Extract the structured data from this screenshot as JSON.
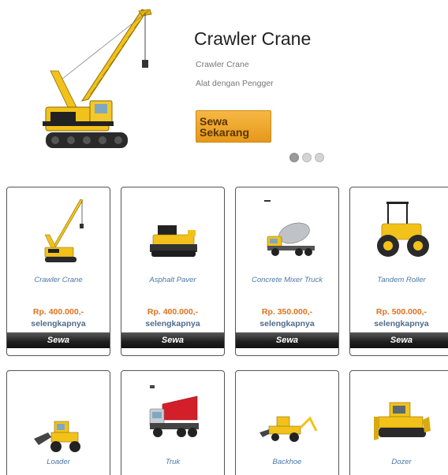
{
  "hero": {
    "title": "Crawler Crane",
    "subtitle": "Crawler Crane",
    "description": "Alat dengan Pengger",
    "button_line1": "Sewa",
    "button_line2": "Sekarang",
    "slide_count": 3,
    "active_slide": 1
  },
  "colors": {
    "accent_orange": "#e6981a",
    "price_orange": "#e0701c",
    "link_blue": "#4a78a8",
    "button_dark": "#1e1e1e"
  },
  "products": [
    {
      "name": "Crawler Crane",
      "price": "Rp. 400.000,-",
      "more": "selengkapnya",
      "action": "Sewa",
      "icon": "crane-icon"
    },
    {
      "name": "Asphalt Paver",
      "price": "Rp. 400.000,-",
      "more": "selengkapnya",
      "action": "Sewa",
      "icon": "asphalt-paver-icon"
    },
    {
      "name": "Concrete Mixer Truck",
      "price": "Rp. 350.000,-",
      "more": "selengkapnya",
      "action": "Sewa",
      "icon": "mixer-truck-icon"
    },
    {
      "name": "Tandem Roller",
      "price": "Rp. 500.000,-",
      "more": "selengkapnya",
      "action": "Sewa",
      "icon": "roller-icon"
    },
    {
      "name": "Loader",
      "icon": "loader-icon"
    },
    {
      "name": "Truk",
      "icon": "dump-truck-icon"
    },
    {
      "name": "Backhoe",
      "icon": "backhoe-icon"
    },
    {
      "name": "Dozer",
      "icon": "dozer-icon"
    }
  ]
}
